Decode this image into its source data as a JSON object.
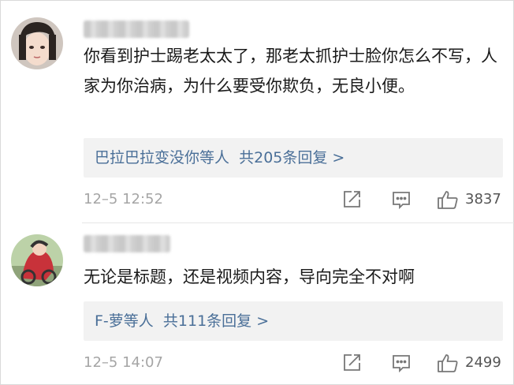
{
  "comments": [
    {
      "text": "你看到护士踢老太太了，那老太抓护士脸你怎么不写，人家为你治病，为什么要受你欺负，无良小便。",
      "replies": {
        "users": "巴拉巴拉变没你等人",
        "count": "共205条回复 >"
      },
      "timestamp": "12–5 12:52",
      "likes": "3837"
    },
    {
      "text": "无论是标题，还是视频内容，导向完全不对啊",
      "replies": {
        "users": "F-萝等人",
        "count": "共111条回复 >"
      },
      "timestamp": "12–5 14:07",
      "likes": "2499"
    }
  ],
  "icons": {
    "share": "share-icon",
    "comment": "comment-icon",
    "like": "thumbs-up-icon"
  }
}
